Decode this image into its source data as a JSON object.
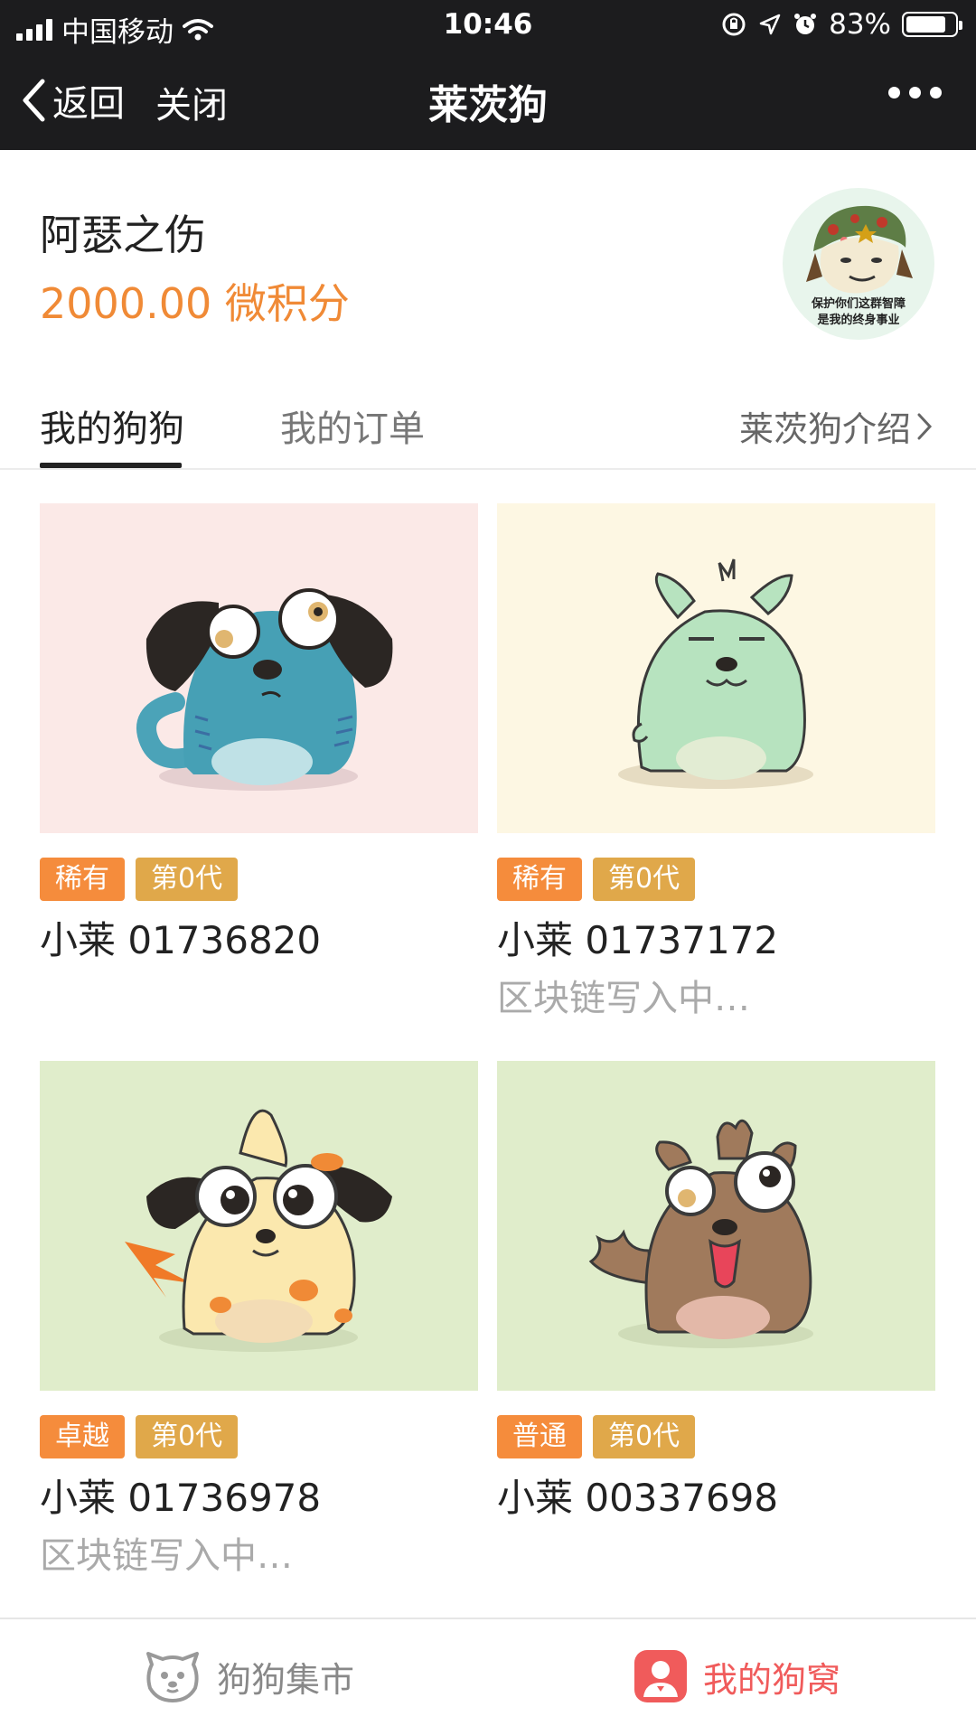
{
  "status_bar": {
    "carrier": "中国移动",
    "time": "10:46",
    "battery": "83%"
  },
  "nav": {
    "back": "返回",
    "close": "关闭",
    "title": "莱茨狗"
  },
  "profile": {
    "username": "阿瑟之伤",
    "points": "2000.00 微积分",
    "avatar_lines": [
      "保护你们这群智障",
      "是我的终身事业"
    ]
  },
  "tabs": {
    "items": [
      {
        "label": "我的狗狗"
      },
      {
        "label": "我的订单"
      }
    ],
    "intro": "莱茨狗介绍"
  },
  "dogs": [
    {
      "rarity": "稀有",
      "gen": "第0代",
      "name": "小莱 01736820",
      "status": "",
      "bg": "#fbe9e7",
      "rarity_color": "#f58c3c"
    },
    {
      "rarity": "稀有",
      "gen": "第0代",
      "name": "小莱 01737172",
      "status": "区块链写入中…",
      "bg": "#fdf7e3",
      "rarity_color": "#f58c3c"
    },
    {
      "rarity": "卓越",
      "gen": "第0代",
      "name": "小莱 01736978",
      "status": "区块链写入中…",
      "bg": "#e0edcb",
      "rarity_color": "#f58c3c"
    },
    {
      "rarity": "普通",
      "gen": "第0代",
      "name": "小莱 00337698",
      "status": "",
      "bg": "#e0edcb",
      "rarity_color": "#f58c3c"
    }
  ],
  "bottom_nav": {
    "market": "狗狗集市",
    "mine": "我的狗窝"
  },
  "colors": {
    "accent_orange": "#f08a36",
    "gen_tag": "#e0a84a",
    "active_red": "#f05b5b"
  }
}
